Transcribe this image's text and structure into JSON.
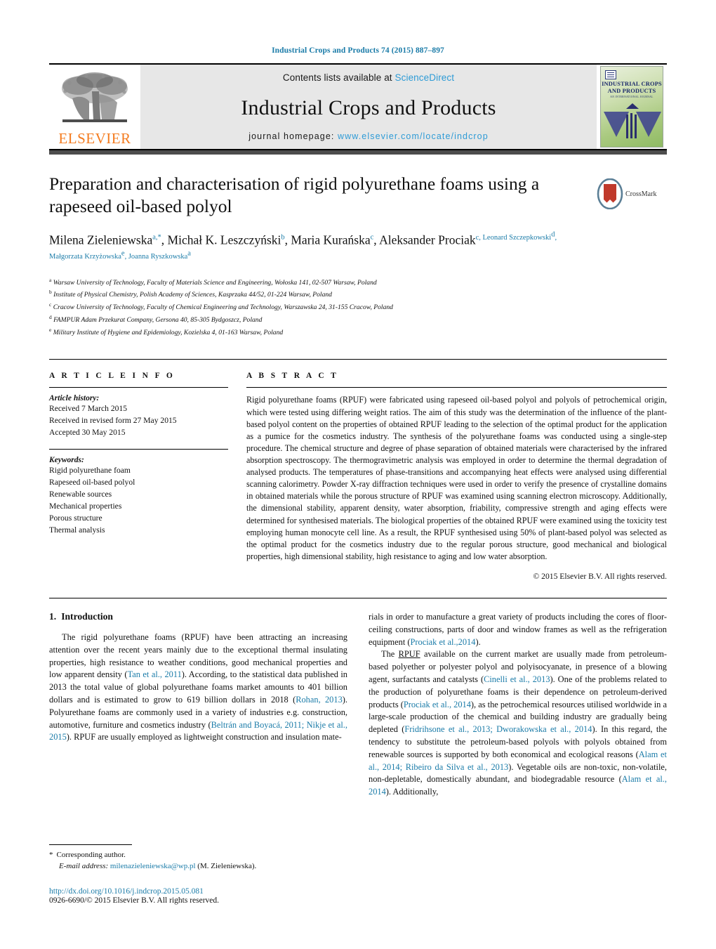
{
  "running_head": "Industrial Crops and Products 74 (2015) 887–897",
  "masthead": {
    "publisher_logo_text": "ELSEVIER",
    "contents_prefix": "Contents lists available at ",
    "contents_link": "ScienceDirect",
    "journal_title": "Industrial Crops and Products",
    "homepage_prefix": "journal homepage: ",
    "homepage_url": "www.elsevier.com/locate/indcrop",
    "cover_title_line1": "INDUSTRIAL CROPS",
    "cover_title_line2": "AND PRODUCTS",
    "cover_subtitle": "AN INTERNATIONAL JOURNAL"
  },
  "article": {
    "title": "Preparation and characterisation of rigid polyurethane foams using a rapeseed oil-based polyol",
    "crossmark_label": "CrossMark",
    "authors_html": "Milena Zieleniewska<sup>a,*</sup>, Michał K. Leszczyński<sup>b</sup>, Maria Kurańska<sup>c</sup>, Aleksander Prociak<sup>c</>, Leonard Szczepkowski<sup>d</sup>, Małgorzata Krzyżowska<sup>e</sup>, Joanna Ryszkowska<sup>a</sup>",
    "affiliations": [
      {
        "mark": "a",
        "text": "Warsaw University of Technology, Faculty of Materials Science and Engineering, Wołoska 141, 02-507 Warsaw, Poland"
      },
      {
        "mark": "b",
        "text": "Institute of Physical Chemistry, Polish Academy of Sciences, Kasprzaka 44/52, 01-224 Warsaw, Poland"
      },
      {
        "mark": "c",
        "text": "Cracow University of Technology, Faculty of Chemical Engineering and Technology, Warszawska 24, 31-155 Cracow, Poland"
      },
      {
        "mark": "d",
        "text": "FAMPUR Adam Przekurat Company, Gersona 40, 85-305 Bydgoszcz, Poland"
      },
      {
        "mark": "e",
        "text": "Military Institute of Hygiene and Epidemiology, Kozielska 4, 01-163 Warsaw, Poland"
      }
    ]
  },
  "article_info": {
    "heading": "A R T I C L E   I N F O",
    "history_label": "Article history:",
    "history": [
      "Received 7 March 2015",
      "Received in revised form 27 May 2015",
      "Accepted 30 May 2015"
    ],
    "keywords_label": "Keywords:",
    "keywords": [
      "Rigid polyurethane foam",
      "Rapeseed oil-based polyol",
      "Renewable sources",
      "Mechanical properties",
      "Porous structure",
      "Thermal analysis"
    ]
  },
  "abstract": {
    "heading": "A B S T R A C T",
    "text": "Rigid polyurethane foams (RPUF) were fabricated using rapeseed oil-based polyol and polyols of petrochemical origin, which were tested using differing weight ratios. The aim of this study was the determination of the influence of the plant-based polyol content on the properties of obtained RPUF leading to the selection of the optimal product for the application as a pumice for the cosmetics industry. The synthesis of the polyurethane foams was conducted using a single-step procedure. The chemical structure and degree of phase separation of obtained materials were characterised by the infrared absorption spectroscopy. The thermogravimetric analysis was employed in order to determine the thermal degradation of analysed products. The temperatures of phase-transitions and accompanying heat effects were analysed using differential scanning calorimetry. Powder X-ray diffraction techniques were used in order to verify the presence of crystalline domains in obtained materials while the porous structure of RPUF was examined using scanning electron microscopy. Additionally, the dimensional stability, apparent density, water absorption, friability, compressive strength and aging effects were determined for synthesised materials. The biological properties of the obtained RPUF were examined using the toxicity test employing human monocyte cell line. As a result, the RPUF synthesised using 50% of plant-based polyol was selected as the optimal product for the cosmetics industry due to the regular porous structure, good mechanical and biological properties, high dimensional stability, high resistance to aging and low water absorption.",
    "copyright": "© 2015 Elsevier B.V. All rights reserved."
  },
  "introduction": {
    "number": "1.",
    "title": "Introduction",
    "left_paragraph_html": "The rigid polyurethane foams (RPUF) have been attracting an increasing attention over the recent years mainly due to the exceptional thermal insulating properties, high resistance to weather conditions, good mechanical properties and low apparent density (<span class=\"ref\">Tan et al., 2011</span>). According, to the statistical data published in 2013 the total value of global polyurethane foams market amounts to 401 billion dollars and is estimated to grow to 619 billion dollars in 2018 (<span class=\"ref\">Rohan, 2013</span>). Polyurethane foams are commonly used in a variety of industries e.g. construction, automotive, furniture and cosmetics industry (<span class=\"ref\">Beltrán and Boyacá, 2011; Nikje et al., 2015</span>). RPUF are usually employed as lightweight construction and insulation mate-",
    "right_paragraph1_html": "rials in order to manufacture a great variety of products including the cores of floor-ceiling constructions, parts of door and window frames as well as the refrigeration equipment (<span class=\"ref\">Prociak et al.,2014</span>).",
    "right_paragraph2_html": "The <span class=\"uline\">RPUF</span> available on the current market are usually made from petroleum-based polyether or polyester polyol and polyisocyanate, in presence of a blowing agent, surfactants and catalysts (<span class=\"ref\">Cinelli et al., 2013</span>). One of the problems related to the production of polyurethane foams is their dependence on petroleum-derived products (<span class=\"ref\">Prociak et al., 2014</span>), as the petrochemical resources utilised worldwide in a large-scale production of the chemical and building industry are gradually being depleted (<span class=\"ref\">Fridrihsone et al., 2013; Dworakowska et al., 2014</span>). In this regard, the tendency to substitute the petroleum-based polyols with polyols obtained from renewable sources is supported by both economical and ecological reasons (<span class=\"ref\">Alam et al., 2014; Ribeiro da Silva et al., 2013</span>). Vegetable oils are non-toxic, non-volatile, non-depletable, domestically abundant, and biodegradable resource (<span class=\"ref\">Alam et al., 2014</span>). Additionally,"
  },
  "footnote": {
    "star": "*",
    "corresponding": "Corresponding author.",
    "email_label": "E-mail address:",
    "email": "milenazieleniewska@wp.pl",
    "email_suffix": "(M. Zieleniewska).",
    "doi": "http://dx.doi.org/10.1016/j.indcrop.2015.05.081",
    "issn": "0926-6690/© 2015 Elsevier B.V. All rights reserved."
  },
  "colors": {
    "link": "#1a7ba8",
    "sciencedirect": "#2e9bd6",
    "elsevier_orange": "#f47c20",
    "masthead_bg": "#e7e7e7"
  }
}
